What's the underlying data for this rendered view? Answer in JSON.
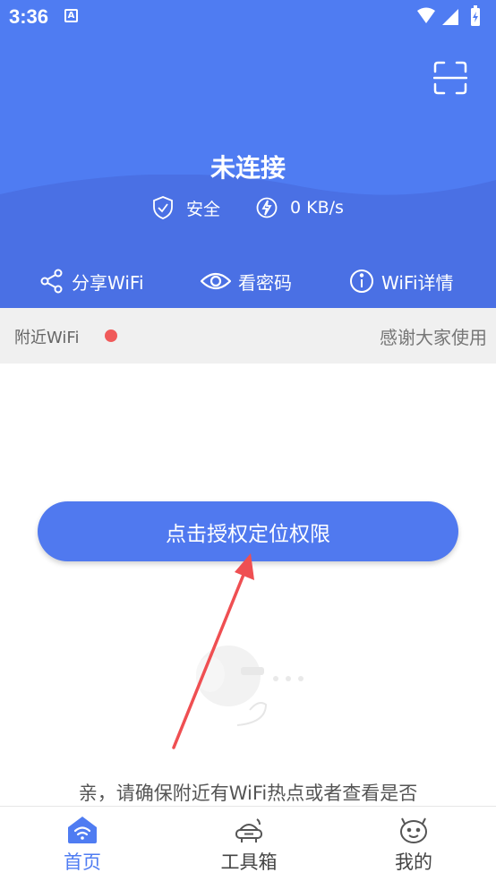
{
  "status_bar": {
    "time": "3:36",
    "notification_icon": "A"
  },
  "header": {
    "connection_status": "未连接",
    "security_label": "安全",
    "speed_label": "0 KB/s",
    "accent_color": "#4f7cf2"
  },
  "actions": {
    "share_label": "分享WiFi",
    "password_label": "看密码",
    "details_label": "WiFi详情"
  },
  "nearby": {
    "label": "附近WiFi",
    "marquee_text": "感谢大家使用"
  },
  "main": {
    "auth_button_label": "点击授权定位权限",
    "hint_text": "亲，请确保附近有WiFi热点或者查看是否"
  },
  "tabbar": {
    "items": [
      {
        "label": "首页",
        "icon": "wifi-home-icon",
        "active": true
      },
      {
        "label": "工具箱",
        "icon": "toolbox-icon",
        "active": false
      },
      {
        "label": "我的",
        "icon": "face-icon",
        "active": false
      }
    ]
  }
}
